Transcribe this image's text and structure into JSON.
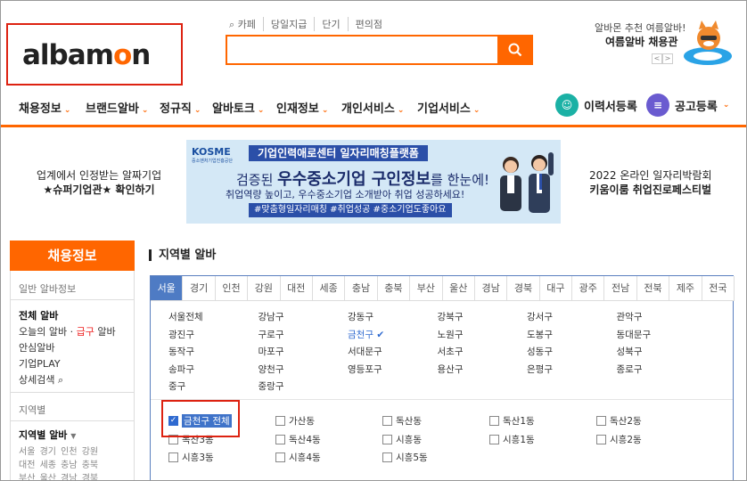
{
  "header": {
    "logo_a": "alb",
    "logo_b": "am",
    "logo_c": "o",
    "logo_d": "n",
    "quick_links": [
      "카페",
      "당일지급",
      "단기",
      "편의점"
    ],
    "promo_line1": "알바몬 추천 여름알바!",
    "promo_line2": "여름알바 채용관",
    "prev": "<",
    "next": ">"
  },
  "nav": {
    "items": [
      "채용정보",
      "브랜드알바",
      "정규직",
      "알바토크",
      "인재정보",
      "개인서비스",
      "기업서비스"
    ],
    "resume": "이력서등록",
    "post": "공고등록"
  },
  "banner": {
    "left_line1": "업계에서 인정받는 알짜기업",
    "left_line2": "★슈퍼기업관★ 확인하기",
    "kosme": "KOSME",
    "kosme_sub": "중소벤처기업진흥공단",
    "top": "기업인력애로센터 일자리매칭플랫폼",
    "main_pre": "검증된 ",
    "main_hl": "우수중소기업 구인정보",
    "main_post": "를 한눈에!",
    "sub": "취업역량 높이고, 우수중소기업 소개받아 취업 성공하세요!",
    "tags": "#맞춤형일자리매칭 #취업성공 #중소기업도좋아요",
    "right_line1": "2022 온라인 일자리박람회",
    "right_line2": "키움이룸 취업진로페스티벌"
  },
  "sidebar": {
    "title": "채용정보",
    "sec1": "일반 알바정보",
    "all": "전체 알바",
    "today_pre": "오늘의 알바 · ",
    "today_red": "급구",
    "today_post": " 알바",
    "safe": "안심알바",
    "company": "기업PLAY",
    "detail": "상세검색",
    "sec2": "지역별",
    "region_alba": "지역별 알바",
    "regions_row1": "서울  경기  인천  강원",
    "regions_row2": "대전  세종  충남  충북",
    "regions_row3": "부산  울산  경남  경북"
  },
  "main": {
    "title": "지역별 알바",
    "tabs": [
      "서울",
      "경기",
      "인천",
      "강원",
      "대전",
      "세종",
      "충남",
      "충북",
      "부산",
      "울산",
      "경남",
      "경북",
      "대구",
      "광주",
      "전남",
      "전북",
      "제주",
      "전국"
    ],
    "active_tab": "서울",
    "districts": [
      "서울전체",
      "강남구",
      "강동구",
      "강북구",
      "강서구",
      "관악구",
      "광진구",
      "구로구",
      "금천구",
      "노원구",
      "도봉구",
      "동대문구",
      "동작구",
      "마포구",
      "서대문구",
      "서초구",
      "성동구",
      "성북구",
      "송파구",
      "양천구",
      "영등포구",
      "용산구",
      "은평구",
      "종로구",
      "중구",
      "중랑구"
    ],
    "selected_district": "금천구",
    "dongs": [
      {
        "label": "금천구 전체",
        "checked": true
      },
      {
        "label": "가산동",
        "checked": false
      },
      {
        "label": "독산동",
        "checked": false
      },
      {
        "label": "독산1동",
        "checked": false
      },
      {
        "label": "독산2동",
        "checked": false
      },
      {
        "label": "독산3동",
        "checked": false
      },
      {
        "label": "독산4동",
        "checked": false
      },
      {
        "label": "시흥동",
        "checked": false
      },
      {
        "label": "시흥1동",
        "checked": false
      },
      {
        "label": "시흥2동",
        "checked": false
      },
      {
        "label": "시흥3동",
        "checked": false
      },
      {
        "label": "시흥4동",
        "checked": false
      },
      {
        "label": "시흥5동",
        "checked": false
      }
    ]
  },
  "colors": {
    "accent": "#ff6600",
    "tab_active": "#4e7bc4",
    "highlight_box": "#dd2211"
  }
}
